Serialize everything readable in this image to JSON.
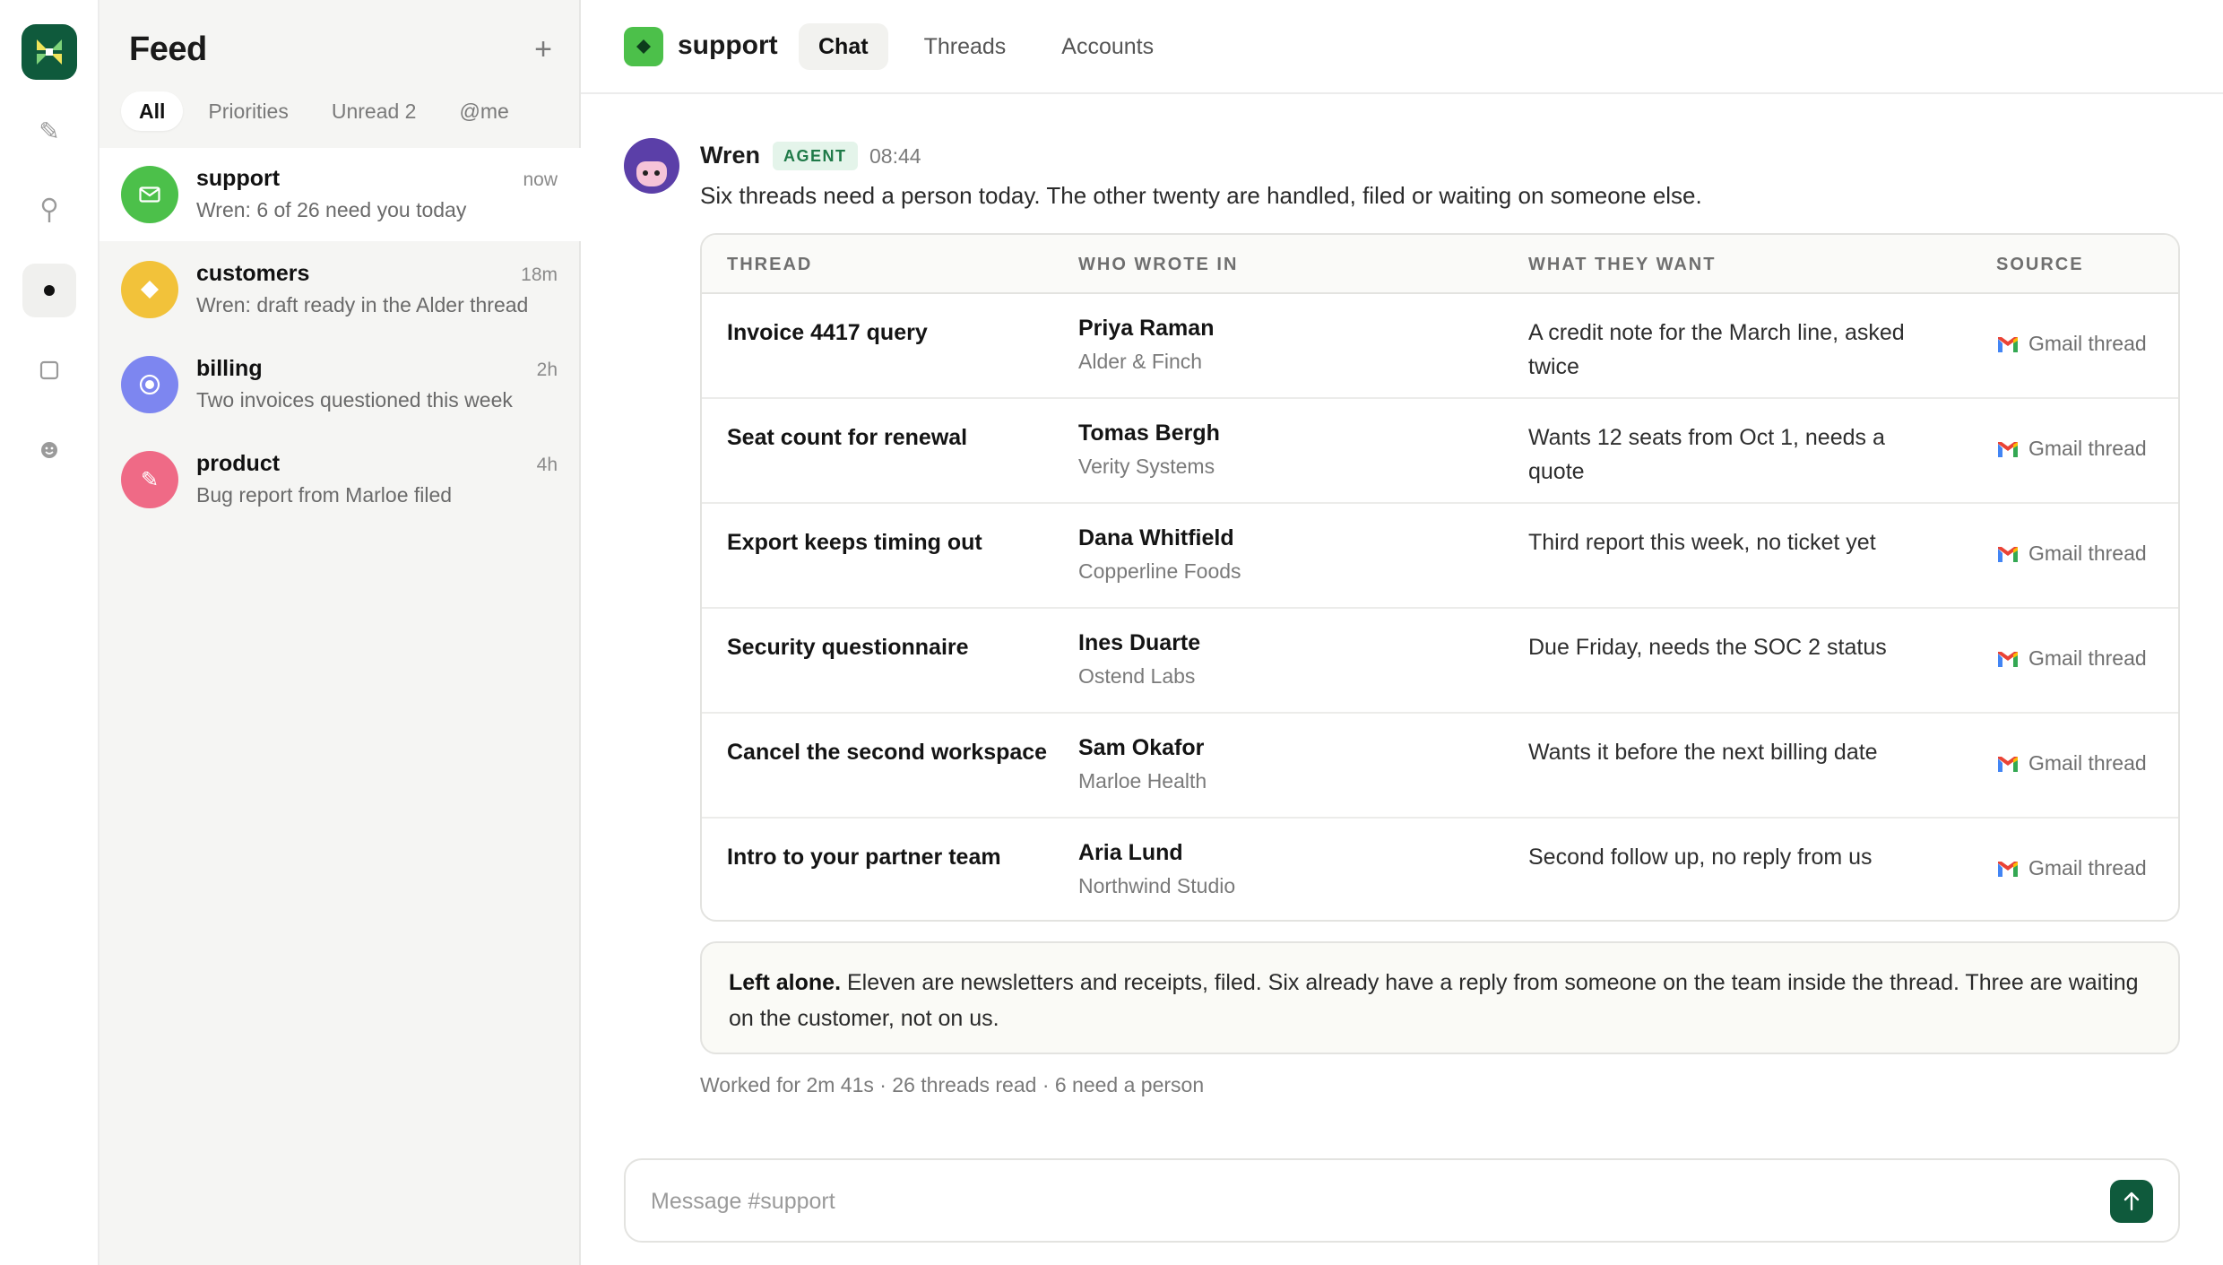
{
  "feed": {
    "title": "Feed",
    "add_label": "+",
    "tabs": [
      {
        "label": "All",
        "active": true
      },
      {
        "label": "Priorities",
        "active": false
      },
      {
        "label": "Unread 2",
        "active": false
      },
      {
        "label": "@me",
        "active": false
      }
    ],
    "channels": [
      {
        "name": "support",
        "time": "now",
        "preview": "Wren: 6 of 26 need you today",
        "color": "#4cc04a",
        "icon": "mail-icon",
        "active": true
      },
      {
        "name": "customers",
        "time": "18m",
        "preview": "Wren: draft ready in the Alder thread",
        "color": "#f2c23a",
        "icon": "diamond-icon",
        "active": false
      },
      {
        "name": "billing",
        "time": "2h",
        "preview": "Two invoices questioned this week",
        "color": "#7d86f0",
        "icon": "target-icon",
        "active": false
      },
      {
        "name": "product",
        "time": "4h",
        "preview": "Bug report from Marloe filed",
        "color": "#ef6a86",
        "icon": "pencil-icon",
        "active": false
      }
    ]
  },
  "rail": {
    "items": [
      {
        "icon": "pencil-icon",
        "active": false
      },
      {
        "icon": "pin-icon",
        "active": false
      },
      {
        "icon": "dot-icon",
        "active": true
      },
      {
        "icon": "square-icon",
        "active": false
      },
      {
        "icon": "face-icon",
        "active": false
      }
    ]
  },
  "header": {
    "channel": "support",
    "tabs": [
      {
        "label": "Chat",
        "active": true
      },
      {
        "label": "Threads",
        "active": false
      },
      {
        "label": "Accounts",
        "active": false
      }
    ]
  },
  "message": {
    "author": "Wren",
    "badge": "AGENT",
    "time": "08:44",
    "text": "Six threads need a person today. The other twenty are handled, filed or waiting on someone else."
  },
  "table": {
    "headers": [
      "THREAD",
      "WHO WROTE IN",
      "WHAT THEY WANT",
      "SOURCE"
    ],
    "rows": [
      {
        "thread": "Invoice 4417 query",
        "name": "Priya Raman",
        "org": "Alder & Finch",
        "want": "A credit note for the March line, asked twice",
        "source": "Gmail thread"
      },
      {
        "thread": "Seat count for renewal",
        "name": "Tomas Bergh",
        "org": "Verity Systems",
        "want": "Wants 12 seats from Oct 1, needs a quote",
        "source": "Gmail thread"
      },
      {
        "thread": "Export keeps timing out",
        "name": "Dana Whitfield",
        "org": "Copperline Foods",
        "want": "Third report this week, no ticket yet",
        "source": "Gmail thread"
      },
      {
        "thread": "Security questionnaire",
        "name": "Ines Duarte",
        "org": "Ostend Labs",
        "want": "Due Friday, needs the SOC 2 status",
        "source": "Gmail thread"
      },
      {
        "thread": "Cancel the second workspace",
        "name": "Sam Okafor",
        "org": "Marloe Health",
        "want": "Wants it before the next billing date",
        "source": "Gmail thread"
      },
      {
        "thread": "Intro to your partner team",
        "name": "Aria Lund",
        "org": "Northwind Studio",
        "want": "Second follow up, no reply from us",
        "source": "Gmail thread"
      }
    ]
  },
  "note": {
    "lead": "Left alone.",
    "text": "Eleven are newsletters and receipts, filed. Six already have a reply from someone on the team inside the thread. Three are waiting on the customer, not on us."
  },
  "summary": "Worked for 2m 41s · 26 threads read · 6 need a person",
  "composer": {
    "placeholder": "Message #support"
  }
}
